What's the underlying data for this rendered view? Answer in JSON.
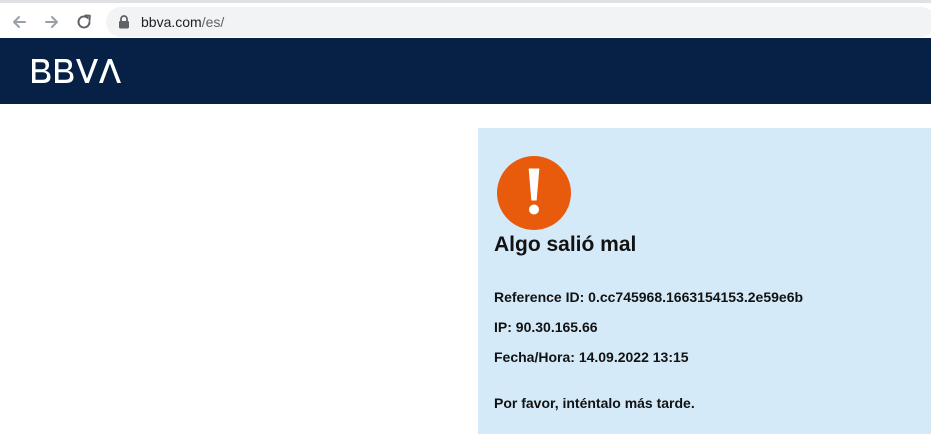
{
  "browser": {
    "url_domain": "bbva.com",
    "url_path": "/es/",
    "back_icon": "arrow-left-icon",
    "forward_icon": "arrow-right-icon",
    "reload_icon": "reload-icon",
    "lock_icon": "lock-icon"
  },
  "header": {
    "logo_text": "BBVA",
    "background_color": "#072146"
  },
  "error": {
    "icon": "warning-icon",
    "icon_color": "#e95b0c",
    "title": "Algo salió mal",
    "reference_label": "Reference ID:",
    "reference_value": "0.cc745968.1663154153.2e59e6b",
    "ip_label": "IP:",
    "ip_value": "90.30.165.66",
    "datetime_label": "Fecha/Hora:",
    "datetime_value": "14.09.2022 13:15",
    "message": "Por favor, inténtalo más tarde.",
    "panel_color": "#d4eaf8"
  }
}
